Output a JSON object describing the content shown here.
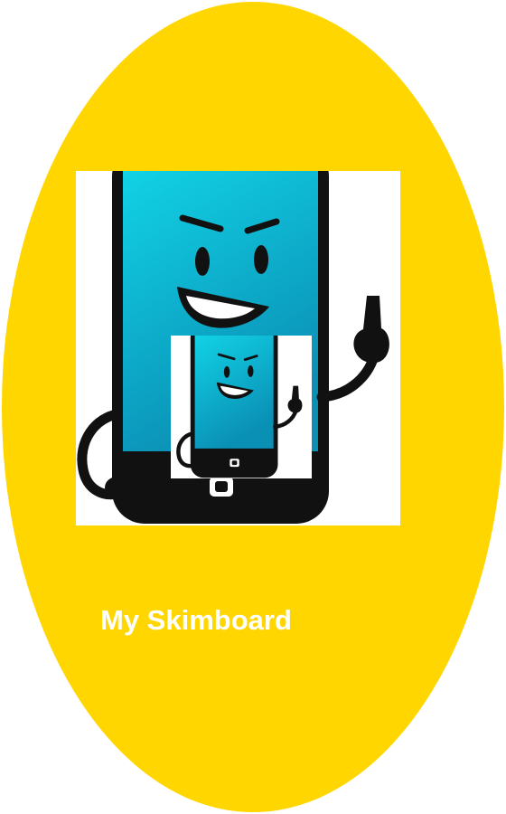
{
  "colors": {
    "background": "#FFD600",
    "label": "#FFFFFF",
    "screen_top": "#12D6E8",
    "screen_bottom": "#0A8FB5",
    "body": "#111111"
  },
  "art": {
    "icon": "phone-character-icon",
    "thumbnail_icon": "phone-character-thumbnail-icon"
  },
  "label": {
    "text": "My Skimboard"
  }
}
